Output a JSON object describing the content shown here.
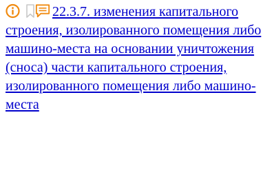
{
  "entry": {
    "icons": {
      "info": "info-circle-icon",
      "bookmark": "bookmark-icon",
      "comment": "comment-icon"
    },
    "colors": {
      "info_icon": "#f08a10",
      "bookmark_icon": "#c8c8c8",
      "comment_icon": "#f08a10",
      "link": "#0000cc"
    },
    "link_text": "22.3.7. изменения капитального строения, изолированного помещения либо машино-места на основании уничтожения (сноса) части капитального строения, изолированного помещения либо машино-места"
  }
}
